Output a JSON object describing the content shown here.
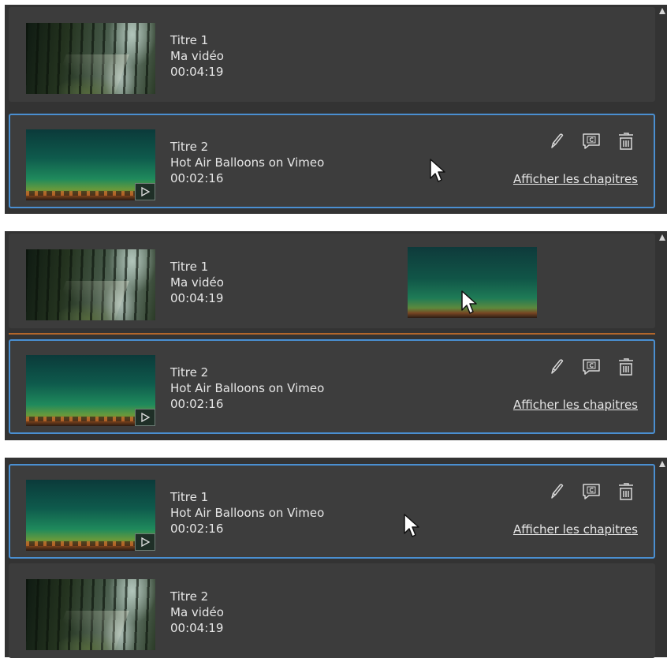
{
  "chapters_link": "Afficher les chapitres",
  "accent_color": "#4a8fd1",
  "drop_line_color": "#b2662b",
  "icons": [
    "edit-icon",
    "captions-icon",
    "trash-icon",
    "play-icon",
    "cursor-icon",
    "scroll-up-arrow-icon"
  ],
  "panel_a": {
    "items": [
      {
        "title": "Titre 1",
        "name": "Ma vidéo",
        "duration": "00:04:19",
        "selected": false
      },
      {
        "title": "Titre 2",
        "name": "Hot Air Balloons on Vimeo",
        "duration": "00:02:16",
        "selected": true
      }
    ]
  },
  "panel_b": {
    "items": [
      {
        "title": "Titre 1",
        "name": "Ma vidéo",
        "duration": "00:04:19",
        "selected": false
      },
      {
        "title": "Titre 2",
        "name": "Hot Air Balloons on Vimeo",
        "duration": "00:02:16",
        "selected": true
      }
    ]
  },
  "panel_c": {
    "items": [
      {
        "title": "Titre 1",
        "name": "Hot Air Balloons on Vimeo",
        "duration": "00:02:16",
        "selected": true
      },
      {
        "title": "Titre 2",
        "name": "Ma vidéo",
        "duration": "00:04:19",
        "selected": false
      }
    ]
  }
}
